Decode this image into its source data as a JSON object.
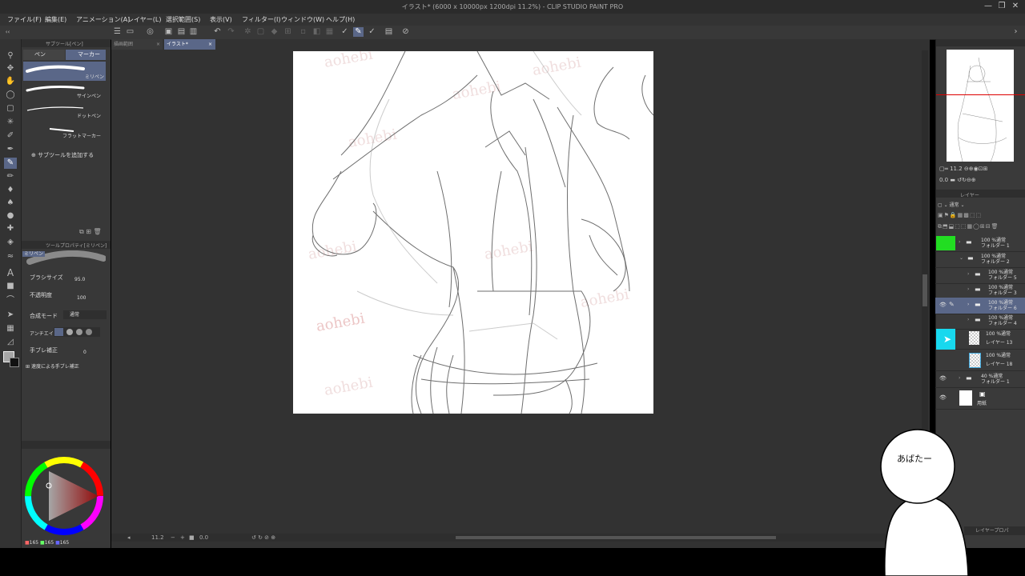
{
  "window": {
    "title": "イラスト* (6000 x 10000px 1200dpi 11.2%) - CLIP STUDIO PAINT PRO"
  },
  "menu": [
    "ファイル(F)",
    "編集(E)",
    "アニメーション(A)",
    "レイヤー(L)",
    "選択範囲(S)",
    "表示(V)",
    "フィルター(I)",
    "ウィンドウ(W)",
    "ヘルプ(H)"
  ],
  "tabs": {
    "inactive": "描画範囲",
    "active": "イラスト*"
  },
  "subtool": {
    "header": "サブツール[ペン]",
    "group_tabs": [
      "ペン",
      "マーカー"
    ],
    "items": [
      {
        "label": "ミリペン",
        "selected": true
      },
      {
        "label": "サインペン"
      },
      {
        "label": "ドットペン"
      },
      {
        "label": "フラットマーカー"
      }
    ],
    "add_label": "サブツールを追加する"
  },
  "tool_property": {
    "header": "ツールプロパティ[ミリペン]",
    "preview_label": "ミリペン",
    "brush_size_label": "ブラシサイズ",
    "brush_size_value": "95.0",
    "opacity_label": "不透明度",
    "opacity_value": "100",
    "blend_label": "合成モード",
    "blend_value": "通常",
    "aa_label": "アンチエイリアス",
    "stabilization_label": "手ブレ補正",
    "stabilization_value": "0",
    "speed_stab_label": "速度による手ブレ補正"
  },
  "color": {
    "r": "165",
    "g": "165",
    "b": "165",
    "accent": "#5a6788"
  },
  "navigator": {
    "zoom": "11.2",
    "rotation": "0.0"
  },
  "layer_panel": {
    "header": "レイヤー",
    "blend": "通常",
    "prop_tab": "レイヤープロパ",
    "layers": [
      {
        "mode": "100 %通常",
        "name": "フォルダー 1",
        "type": "folder",
        "color": "#22dd22",
        "visible": false
      },
      {
        "mode": "100 %通常",
        "name": "フォルダー 2",
        "type": "folder",
        "open": true,
        "visible": false
      },
      {
        "mode": "100 %通常",
        "name": "フォルダー 5",
        "type": "folder",
        "visible": false
      },
      {
        "mode": "100 %通常",
        "name": "フォルダー 3",
        "type": "folder",
        "visible": false
      },
      {
        "mode": "100 %通常",
        "name": "フォルダー 6",
        "type": "folder",
        "selected": true,
        "visible": true
      },
      {
        "mode": "100 %通常",
        "name": "フォルダー 4",
        "type": "folder",
        "visible": false
      },
      {
        "mode": "100 %通常",
        "name": "レイヤー 13",
        "type": "raster",
        "color": "#18d8ee",
        "visible": false
      },
      {
        "mode": "100 %通常",
        "name": "レイヤー 18",
        "type": "raster",
        "visible": false
      },
      {
        "mode": "40 %通常",
        "name": "フォルダー 1",
        "type": "folder",
        "visible": true
      },
      {
        "mode": "",
        "name": "用紙",
        "type": "paper",
        "visible": true
      }
    ]
  },
  "canvas": {
    "watermark": "aohebi"
  },
  "status": {
    "zoom": "11.2",
    "angle": "0.0"
  },
  "character": {
    "speech": "あばたー"
  }
}
